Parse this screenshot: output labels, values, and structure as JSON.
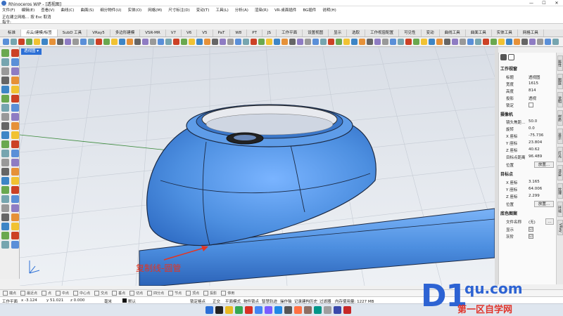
{
  "window": {
    "title": "Rhinoceros WIP - [透视图]",
    "controls": [
      "—",
      "☐",
      "✕"
    ]
  },
  "menu": [
    "文件(F)",
    "编辑(E)",
    "查看(V)",
    "曲线(C)",
    "曲面(S)",
    "细分物件(U)",
    "实体(O)",
    "网格(M)",
    "尺寸标注(D)",
    "变动(T)",
    "工具(L)",
    "分析(A)",
    "渲染(R)",
    "VR-桌面插件",
    "BG插件",
    "说明(H)"
  ],
  "command": {
    "history": "正在建立网格… 按 Esc 取消",
    "prompt": "指令:"
  },
  "tabs": [
    "标准",
    "点云/建模/标签",
    "SubD 工具",
    "VRay5",
    "多边形建模",
    "VSR-MR",
    "V7",
    "V6",
    "V5",
    "PaT",
    "W8",
    "PT",
    "JS",
    "工作平面",
    "设置视图",
    "显示",
    "选取",
    "工作视窗配置",
    "可见性",
    "变动",
    "曲线工具",
    "曲面工具",
    "实体工具",
    "网格工具"
  ],
  "viewport": {
    "label": "透视图 ▾"
  },
  "annotation": "复制线-圆管",
  "panel": {
    "sections": {
      "viewport": "工作视窗",
      "camera": "摄像机",
      "target": "目标点",
      "wallpaper": "底色图案"
    },
    "viewport_rows": [
      {
        "k": "标题",
        "v": "透视图"
      },
      {
        "k": "宽度",
        "v": "1615"
      },
      {
        "k": "高度",
        "v": "814"
      },
      {
        "k": "投影",
        "v": "透视"
      },
      {
        "k": "锁定",
        "v": ""
      }
    ],
    "camera_rows": [
      {
        "k": "镜头焦距…",
        "v": "50.0"
      },
      {
        "k": "旋转",
        "v": "0.0"
      },
      {
        "k": "X 座标",
        "v": "-75.736"
      },
      {
        "k": "Y 座标",
        "v": "23.804"
      },
      {
        "k": "Z 座标",
        "v": "40.62"
      },
      {
        "k": "目标点距离",
        "v": "96.489"
      },
      {
        "k": "位置",
        "v": "放置..."
      }
    ],
    "target_rows": [
      {
        "k": "X 座标",
        "v": "3.165"
      },
      {
        "k": "Y 座标",
        "v": "64.006"
      },
      {
        "k": "Z 座标",
        "v": "2.299"
      },
      {
        "k": "位置",
        "v": "放置..."
      }
    ],
    "wallpaper_rows": [
      {
        "k": "文件名称",
        "v": "(无)"
      },
      {
        "k": "显示",
        "v": "☑"
      },
      {
        "k": "灰阶",
        "v": "☑"
      }
    ]
  },
  "side_tabs": [
    "属性",
    "图层",
    "说明",
    "材质",
    "显示",
    "灯光",
    "渲染",
    "纹理",
    "环境",
    "VRay"
  ],
  "osnap": [
    "端点",
    "最近点",
    "点",
    "中点",
    "中心点",
    "交点",
    "垂点",
    "切点",
    "四分点",
    "节点",
    "顶点",
    "投影",
    "停用"
  ],
  "status": {
    "plane": "工作平面",
    "x": "x -3.124",
    "y": "y 51.021",
    "z": "z 0.000",
    "unit": "毫米",
    "layer": "默认",
    "toggles": [
      "锁定格点",
      "正交",
      "平面模式",
      "物件锁点",
      "智慧轨迹",
      "操作轴",
      "记录建构历史",
      "过滤器"
    ],
    "memory": "内存使用量: 1227 MB"
  },
  "watermark": {
    "big": "D1",
    "url": "qu.com",
    "sub": "第一区自学网"
  },
  "colors": {
    "accent": "#2b6fd6",
    "model": "#4d8fe0",
    "annotation": "#e6341f"
  }
}
